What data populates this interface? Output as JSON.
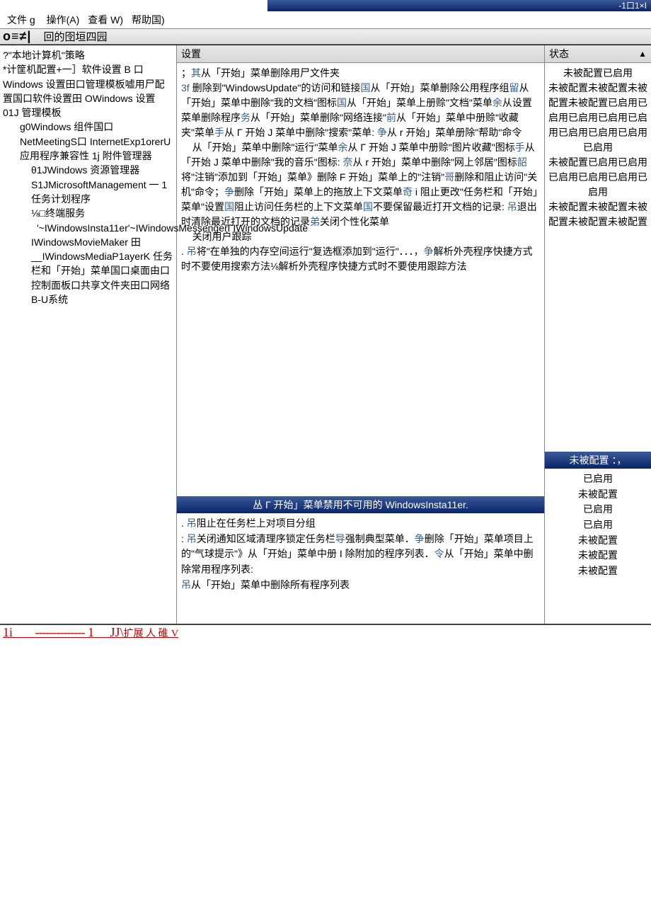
{
  "titlebar": {
    "controls": "-1口1×I"
  },
  "menu": {
    "file": "文件 g",
    "action": "操作(A)",
    "view": "查看 W)",
    "help": "帮助国)"
  },
  "toolbar": {
    "left": "o≡≠|",
    "right": "回的囹垣四园"
  },
  "columns": {
    "settings": "设置",
    "status": "状态"
  },
  "tree": {
    "l0a": "?\"本地计算机\"策略",
    "l0b": "*计筐机配置+一］软件设置 B 口Windows 设置田口管理模板嘘用尸配置国口软件设置田 OWindows 设置 01J 管理模板",
    "l1a": "g0Windows 组件国口 NetMeetingS口 InternetExp1orerU 应用程序兼容性 1j 附件管理器",
    "l2a": "θ1JWindows 资源管理器",
    "l2b": "S1JMicrosoftManagement 一 1 任务计划程序",
    "l2c": "⅛□终端服务",
    "l3a": "'~IWindowsInsta11er'~IWindowsMessengerΓIWindowsUpdate",
    "l2d": "IWindowsMovieMaker 田__IWindowsMediaP1ayerK 任务栏和「开始」菜单国口桌面由口控制面板口共享文件夹田口网络 B-U系统"
  },
  "settings_top": {
    "s0a": "；",
    "s0b": "其",
    "s0c": "从「开始」菜单删除用尸文件夹",
    "s1a": "3f ",
    "s1b": "删除到\"WindowsUpdate\"的访问和链接",
    "s1c": "国",
    "s1d": "从「开始」菜单删除公用程序组",
    "s1e": "留",
    "s1f": "从「开始」菜单中删除\"我的文档\"图标",
    "s1g": "国",
    "s1h": "从「开始」菜单上册赊\"文档\"菜单",
    "s1i": "余",
    "s1j": "从设置菜单删除程序",
    "s1k": "务",
    "s1l": "从「开始」菜单删除\"网络连接\"",
    "s1m": "前",
    "s1n": "从「开始」菜单中册赊\"收藏夹\"菜单",
    "s1o": "手",
    "s1p": "从 Γ 开始 J 菜单中删除\"搜索\"菜单",
    "s1q": "争",
    "s1r": "从 r 开始」菜单册除\"帮助\"命令",
    "s2a": "从「开始」菜单中删除\"运行\"菜单",
    "s2b": "余",
    "s2c": "从 Γ 开始 J 菜单中册赊\"图片收藏\"图标",
    "s2d": "手",
    "s2e": "从「开始 J 菜单中删除\"我的音乐\"图标",
    "s2f": "奈",
    "s2g": "从 r 开始」菜单中删除\"网上邻居\"图标",
    "s2h": "韶",
    "s2i": "将\"注销\"添加到「开始」菜单》删除 F 开始」菜单上的\"注销\"",
    "s2j": "哥",
    "s2k": "删除和阻止访问\"关机\"命令；",
    "s2l": "争",
    "s2m": "删除「开始」菜单上的拖放上下文菜单",
    "s2n": "奇",
    "s2o": " i 阻止更改\"任务栏和「开始」菜单\"设置",
    "s2p": "国",
    "s2q": "阻止访问任务栏的上下文菜单",
    "s2r": "国",
    "s2s": "不要保留最近打开文档的记录",
    "s2t": "吊",
    "s2u": "退出时清除最近打开的文档的记录",
    "s2v": "弟",
    "s2w": "关闭个性化菜单",
    "s3a": "关闭用户跟踪",
    "s3b": "吊",
    "s3c": "将\"在单独的内存空间运行\"复选框添加到\"运行\"．．．",
    "s3d": "争",
    "s3e": "解析外壳程序快捷方式时不要使用搜索方法⅛解析外壳程序快捷方式时不要使用跟踪方法"
  },
  "status_top": {
    "r1": "未被配置已启用",
    "r2": "未被配置未被配置未被配置未被配置已启用已启用已启用已启用已启用已启用已启用已启用已启用",
    "r3": "未被配置已启用已启用已启用已启用已启用已启用",
    "r4": "未被配置未被配置未被配置未被配置未被配置"
  },
  "highlight": {
    "text": "丛 Γ 开始」菜单禁用不可用的 WindowsInsta11er.",
    "status": "未被配置",
    "status_suffix": "：，"
  },
  "settings_bottom": {
    "b1a": "吊",
    "b1b": "阻止在任务栏上对项目分组",
    "b2a": "吊",
    "b2b": "关闭通知区域清理序锁定",
    "b2c": "任务栏",
    "b2d": "导",
    "b2e": "强制典型菜单．",
    "b2f": "争",
    "b2g": "删除「开始」菜单项目上的\"气球提示\"》从「开始」菜单中册 I 除附加的程序列表．",
    "b2h": "令",
    "b2i": "从「开始」菜单中删除常用程序列表",
    "b3a": "吊",
    "b3b": "从「开始」菜单中删除所有程序列表"
  },
  "status_bottom": {
    "r1": "已启用",
    "r2": "未被配置",
    "r3": "已启用",
    "r4": "已启用",
    "r5": "未被配置",
    "r6": "未被配置",
    "r7": "未被配置"
  },
  "footer": {
    "left": "1i",
    "dashes": "--------------",
    "one": "1",
    "jj": "JJ\\",
    "text": "扩展 人 碓",
    "v": "V"
  }
}
